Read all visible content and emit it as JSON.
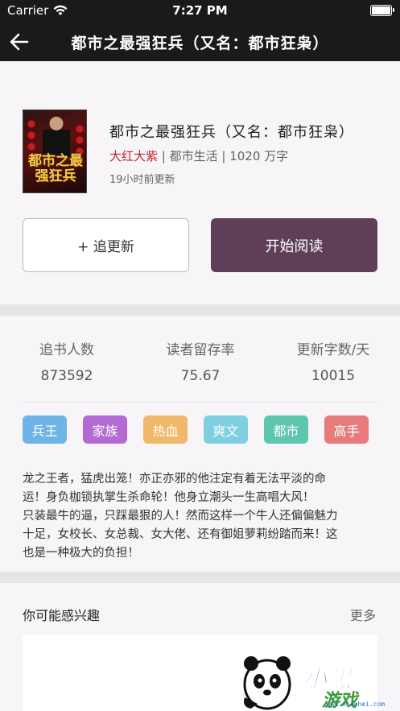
{
  "status_bar": {
    "carrier": "Carrier",
    "time": "7:27 PM"
  },
  "nav": {
    "title": "都市之最强狂兵（又名：都市狂枭）"
  },
  "book": {
    "cover_text": "都市之最强狂兵",
    "title": "都市之最强狂兵（又名：都市狂枭）",
    "author": "大红大紫",
    "category": "都市生活",
    "word_count": "1020 万字",
    "separator": " | ",
    "updated": "19小时前更新"
  },
  "actions": {
    "follow_label": "+ 追更新",
    "read_label": "开始阅读"
  },
  "stats": [
    {
      "label": "追书人数",
      "value": "873592"
    },
    {
      "label": "读者留存率",
      "value": "75.67"
    },
    {
      "label": "更新字数/天",
      "value": "10015"
    }
  ],
  "tags": [
    {
      "label": "兵王",
      "color": "#6fb4e6"
    },
    {
      "label": "家族",
      "color": "#b36ad2"
    },
    {
      "label": "热血",
      "color": "#f0b86a"
    },
    {
      "label": "爽文",
      "color": "#7fcfe0"
    },
    {
      "label": "都市",
      "color": "#5cc7ad"
    },
    {
      "label": "高手",
      "color": "#e77b7b"
    }
  ],
  "description": [
    "龙之王者，猛虎出笼！亦正亦邪的他注定有着无法平淡的命",
    "运！身负枷锁执掌生杀命轮！他身立潮头一生高唱大风！",
    "只装最牛的逼，只踩最狠的人！然而这样一个牛人还偏偏魅力",
    "十足，女校长、女总裁、女大佬、还有御姐萝莉纷踏而来！这",
    "也是一种极大的负担！"
  ],
  "recommend": {
    "title": "你可能感兴趣",
    "more_label": "更多"
  },
  "watermark": {
    "text": "小黑",
    "sub": "游戏",
    "url": "www.xiaohei.com"
  },
  "colors": {
    "nav_bg": "#1a1a1a",
    "read_button": "#5e3f57",
    "author": "#c0262d"
  }
}
